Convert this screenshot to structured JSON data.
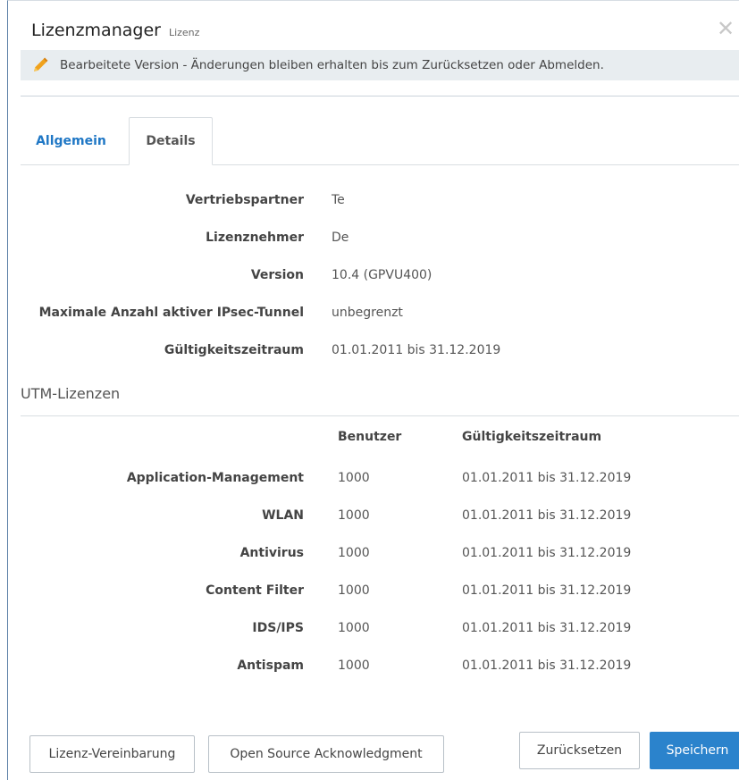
{
  "dialog": {
    "title": "Lizenzmanager",
    "subtitle": "Lizenz",
    "close_symbol": "✕",
    "close_icon": "close-icon"
  },
  "notice": {
    "text": "Bearbeitete Version - Änderungen bleiben erhalten bis zum Zurücksetzen oder Abmelden.",
    "icon": "pencil-icon",
    "icon_color": "#f0a21c",
    "background": "#e8edf0"
  },
  "tabs": [
    {
      "label": "Allgemein",
      "active": false
    },
    {
      "label": "Details",
      "active": true
    }
  ],
  "details": [
    {
      "label": "Vertriebspartner",
      "value": "Te"
    },
    {
      "label": "Lizenznehmer",
      "value": "De"
    },
    {
      "label": "Version",
      "value": "10.4 (GPVU400)"
    },
    {
      "label": "Maximale Anzahl aktiver IPsec-Tunnel",
      "value": "unbegrenzt"
    },
    {
      "label": "Gültigkeitszeitraum",
      "value": "01.01.2011 bis 31.12.2019"
    }
  ],
  "utm": {
    "title": "UTM-Lizenzen",
    "columns": [
      "Benutzer",
      "Gültigkeitszeitraum"
    ],
    "rows": [
      {
        "name": "Application-Management",
        "users": "1000",
        "validity": "01.01.2011 bis 31.12.2019"
      },
      {
        "name": "WLAN",
        "users": "1000",
        "validity": "01.01.2011 bis 31.12.2019"
      },
      {
        "name": "Antivirus",
        "users": "1000",
        "validity": "01.01.2011 bis 31.12.2019"
      },
      {
        "name": "Content Filter",
        "users": "1000",
        "validity": "01.01.2011 bis 31.12.2019"
      },
      {
        "name": "IDS/IPS",
        "users": "1000",
        "validity": "01.01.2011 bis 31.12.2019"
      },
      {
        "name": "Antispam",
        "users": "1000",
        "validity": "01.01.2011 bis 31.12.2019"
      }
    ]
  },
  "buttons": {
    "license_agreement": "Lizenz-Vereinbarung",
    "open_source": "Open Source Acknowledgment",
    "reset": "Zurücksetzen",
    "save": "Speichern"
  },
  "colors": {
    "accent": "#2b83cc",
    "tab_link": "#1f77c5"
  }
}
